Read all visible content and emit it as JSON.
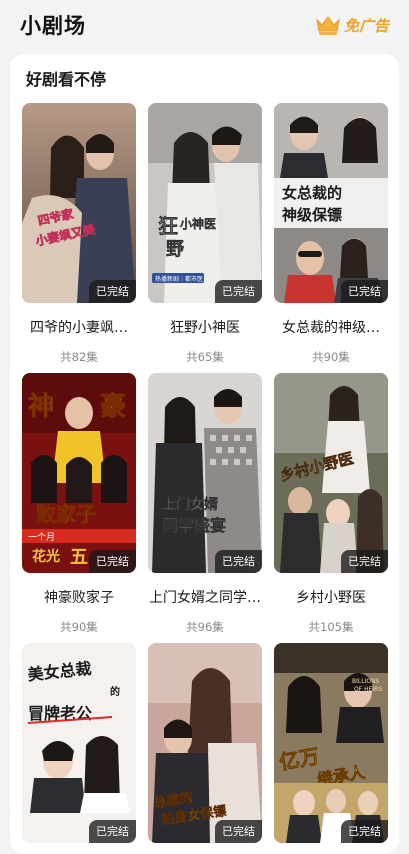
{
  "header": {
    "title": "小剧场",
    "no_ad_label": "免广告",
    "crown_icon": "crown-icon",
    "accent": "#f0a21e"
  },
  "section": {
    "title": "好剧看不停"
  },
  "dramas": [
    {
      "title": "四爷的小妻飒…",
      "episodes": "共82集",
      "status": "已完结",
      "poster_text": "四爷的小妻飒又美"
    },
    {
      "title": "狂野小神医",
      "episodes": "共65集",
      "status": "已完结",
      "poster_text": "狂野小神医",
      "poster_tags": "热播新剧｜都市医"
    },
    {
      "title": "女总裁的神级…",
      "episodes": "共90集",
      "status": "已完结",
      "poster_text": "女总裁的神级保镖"
    },
    {
      "title": "神豪败家子",
      "episodes": "共90集",
      "status": "已完结",
      "poster_text": "神豪败家子",
      "poster_extra": "一个月 花光五亿"
    },
    {
      "title": "上门女婿之同学…",
      "episodes": "共96集",
      "status": "已完结",
      "poster_text": "上门女婿 同学盛宴"
    },
    {
      "title": "乡村小野医",
      "episodes": "共105集",
      "status": "已完结",
      "poster_text": "乡村小野医"
    },
    {
      "title": "",
      "episodes": "",
      "status": "已完结",
      "poster_text": "美女总裁的冒牌老公"
    },
    {
      "title": "",
      "episodes": "",
      "status": "已完结",
      "poster_text": "总裁的贴身女保镖"
    },
    {
      "title": "",
      "episodes": "",
      "status": "已完结",
      "poster_text": "亿万继承人",
      "poster_extra": "BILLIONS OF HEIRS"
    }
  ]
}
